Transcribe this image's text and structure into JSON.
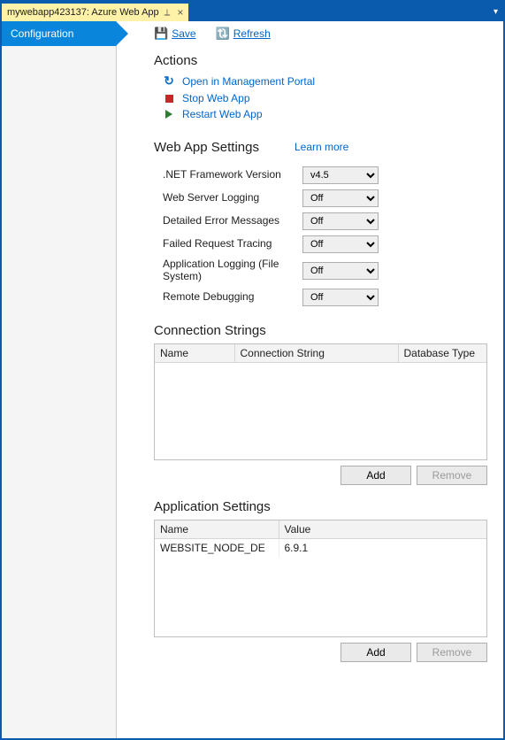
{
  "tab": {
    "title": "mywebapp423137: Azure Web App"
  },
  "sidebar": {
    "items": [
      {
        "label": "Configuration"
      }
    ]
  },
  "toolbar": {
    "save_label": "Save",
    "refresh_label": "Refresh"
  },
  "actions": {
    "heading": "Actions",
    "open_portal": "Open in Management Portal",
    "stop": "Stop Web App",
    "restart": "Restart Web App"
  },
  "settings": {
    "heading": "Web App Settings",
    "learn_more": "Learn more",
    "rows": [
      {
        "label": ".NET Framework Version",
        "value": "v4.5"
      },
      {
        "label": "Web Server Logging",
        "value": "Off"
      },
      {
        "label": "Detailed Error Messages",
        "value": "Off"
      },
      {
        "label": "Failed Request Tracing",
        "value": "Off"
      },
      {
        "label": "Application Logging (File System)",
        "value": "Off"
      },
      {
        "label": "Remote Debugging",
        "value": "Off"
      }
    ]
  },
  "connstrings": {
    "heading": "Connection Strings",
    "cols": {
      "name": "Name",
      "conn": "Connection String",
      "dbtype": "Database Type"
    },
    "add": "Add",
    "remove": "Remove"
  },
  "appsettings": {
    "heading": "Application Settings",
    "cols": {
      "name": "Name",
      "value": "Value"
    },
    "rows": [
      {
        "name": "WEBSITE_NODE_DE",
        "value": "6.9.1"
      }
    ],
    "add": "Add",
    "remove": "Remove"
  }
}
